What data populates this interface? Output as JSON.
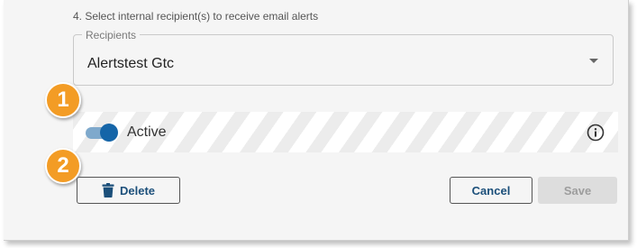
{
  "section": {
    "step_label": "4. Select internal recipient(s) to receive email alerts"
  },
  "recipients": {
    "legend": "Recipients",
    "value": "Alertstest Gtc",
    "caret_icon": "caret-down-icon"
  },
  "status": {
    "toggle_on": true,
    "label": "Active",
    "info_icon": "info-icon",
    "accent_color": "#1565a8"
  },
  "callouts": [
    {
      "number": "1",
      "color": "#f39c25"
    },
    {
      "number": "2",
      "color": "#f39c25"
    }
  ],
  "actions": {
    "delete_label": "Delete",
    "delete_icon": "trash-icon",
    "cancel_label": "Cancel",
    "save_label": "Save",
    "save_enabled": false
  }
}
